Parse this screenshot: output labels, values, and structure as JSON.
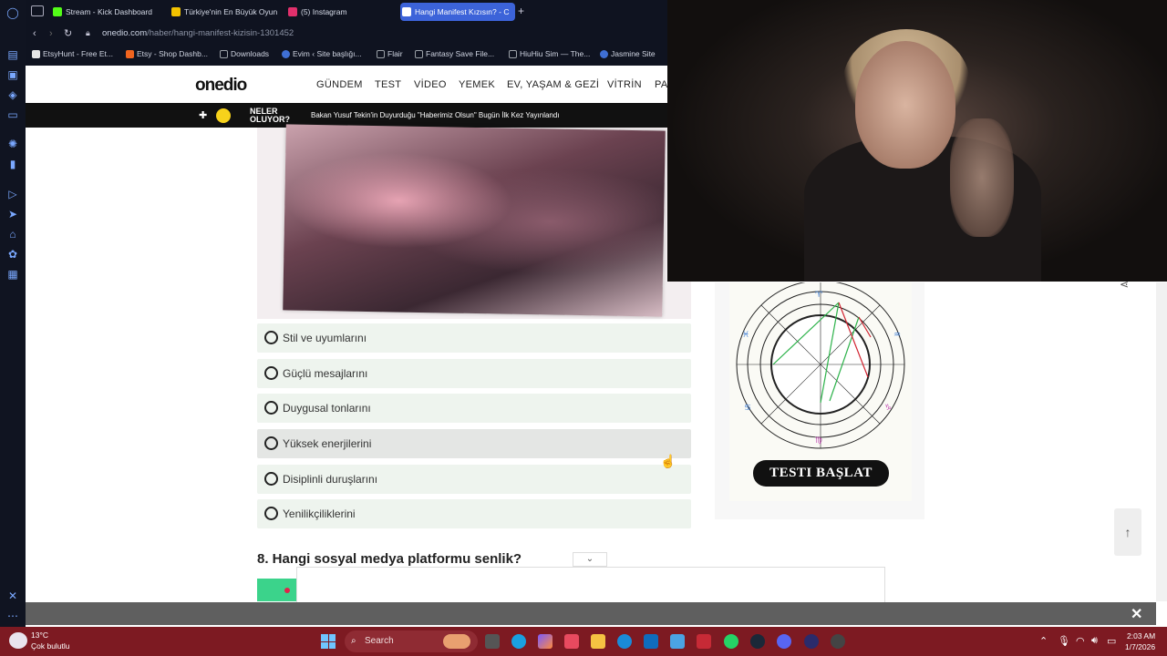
{
  "browser": {
    "tabs": [
      {
        "label": "Stream - Kick Dashboard",
        "color": "#53fc18"
      },
      {
        "label": "Türkiye'nin En Büyük Oyun",
        "color": "#f2c200"
      },
      {
        "label": "(5) Instagram",
        "color": "#e1306c"
      },
      {
        "label": "Hangi Manifest Kızısın? - C",
        "color": "#1c9bd6"
      }
    ],
    "new_tab": "+",
    "url_host": "onedio.com",
    "url_path": "/haber/hangi-manifest-kizisin-1301452",
    "bookmarks": [
      {
        "label": "EtsyHunt - Free Et...",
        "color": "#e6e6e6"
      },
      {
        "label": "Etsy - Shop Dashb...",
        "color": "#f1641e"
      },
      {
        "label": "Downloads",
        "color": "#9aa0a6"
      },
      {
        "label": "Evim ‹ Site başlığı...",
        "color": "#3f6fd4"
      },
      {
        "label": "Flair",
        "color": "#9aa0a6"
      },
      {
        "label": "Fantasy Save File...",
        "color": "#9aa0a6"
      },
      {
        "label": "HiuHiu Sim — The...",
        "color": "#9aa0a6"
      },
      {
        "label": "Jasmine Site",
        "color": "#3f6fd4"
      }
    ]
  },
  "site": {
    "logo": "onedio",
    "nav": [
      "GÜNDEM",
      "TEST",
      "VİDEO",
      "YEMEK",
      "EV, YAŞAM & GEZİ",
      "VİTRİN",
      "PA"
    ],
    "ticker_label_1": "NELER",
    "ticker_label_2": "OLUYOR?",
    "ticker_news": "Bakan Yusuf Tekin'in Duyurduğu \"Haberimiz Olsun\" Bugün İlk Kez Yayınlandı"
  },
  "quiz": {
    "options": [
      "Stil ve uyumlarını",
      "Güçlü mesajlarını",
      "Duygusal tonlarını",
      "Yüksek enerjilerini",
      "Disiplinli duruşlarını",
      "Yenilikçiliklerini"
    ],
    "next_question": "8. Hangi sosyal medya platformu senlik?"
  },
  "sidebar_ad": {
    "button_label": "TESTI BAŞLAT"
  },
  "taskbar": {
    "temp": "13°C",
    "weather": "Çok bulutlu",
    "search": "Search",
    "time": "2:03 AM",
    "date": "1/7/2026"
  },
  "colors": {
    "accent_tab": "#3c63d9",
    "taskbar": "#7d1a22"
  }
}
